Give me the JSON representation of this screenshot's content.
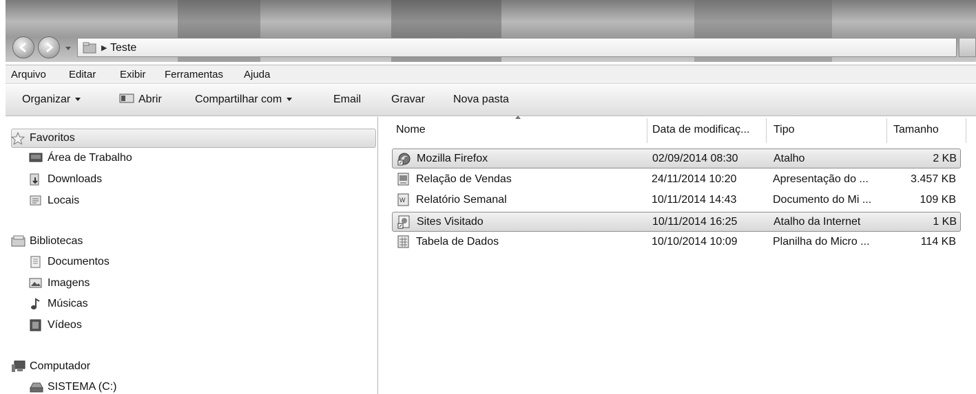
{
  "window": {
    "address": {
      "crumb": "Teste"
    }
  },
  "menu": [
    "Arquivo",
    "Editar",
    "Exibir",
    "Ferramentas",
    "Ajuda"
  ],
  "toolbar": {
    "organize": "Organizar",
    "open": "Abrir",
    "share": "Compartilhar com",
    "email": "Email",
    "burn": "Gravar",
    "new_folder": "Nova pasta"
  },
  "nav": {
    "favorites": {
      "label": "Favoritos",
      "items": [
        "Área de Trabalho",
        "Downloads",
        "Locais"
      ]
    },
    "libraries": {
      "label": "Bibliotecas",
      "items": [
        "Documentos",
        "Imagens",
        "Músicas",
        "Vídeos"
      ]
    },
    "computer": {
      "label": "Computador",
      "items": [
        "SISTEMA (C:)"
      ]
    }
  },
  "columns": [
    "Nome",
    "Data de modificaç...",
    "Tipo",
    "Tamanho"
  ],
  "files": [
    {
      "name": "Mozilla Firefox",
      "date": "02/09/2014 08:30",
      "type": "Atalho",
      "size": "2 KB",
      "selected": true,
      "icon": "firefox-shortcut-icon"
    },
    {
      "name": "Relação de Vendas",
      "date": "24/11/2014 10:20",
      "type": "Apresentação do ...",
      "size": "3.457 KB",
      "selected": false,
      "icon": "presentation-file-icon"
    },
    {
      "name": "Relatório Semanal",
      "date": "10/11/2014 14:43",
      "type": "Documento do Mi ...",
      "size": "109 KB",
      "selected": false,
      "icon": "word-document-icon"
    },
    {
      "name": "Sites Visitado",
      "date": "10/11/2014 16:25",
      "type": "Atalho da Internet",
      "size": "1 KB",
      "selected": true,
      "icon": "internet-shortcut-icon"
    },
    {
      "name": "Tabela de Dados",
      "date": "10/10/2014 10:09",
      "type": "Planilha do Micro ...",
      "size": "114 KB",
      "selected": false,
      "icon": "spreadsheet-file-icon"
    }
  ]
}
